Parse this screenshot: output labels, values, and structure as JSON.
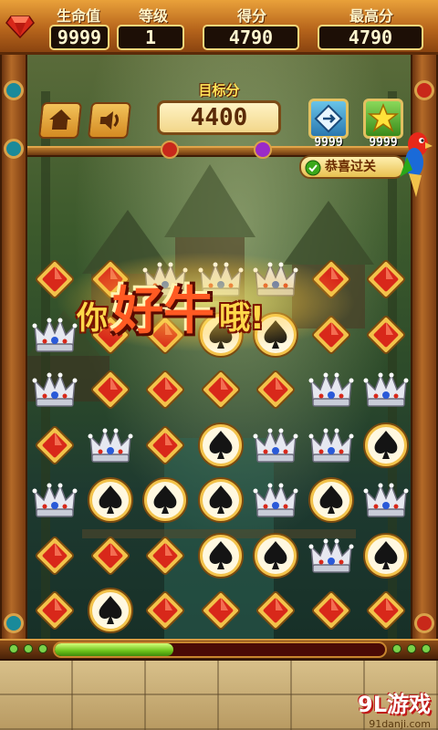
{
  "stats": {
    "lives_label": "生命值",
    "lives_value": "9999",
    "level_label": "等级",
    "level_value": "1",
    "score_label": "得分",
    "score_value": "4790",
    "best_label": "最高分",
    "best_value": "4790"
  },
  "hud": {
    "home_icon": "home-icon",
    "sound_icon": "sound-icon",
    "target_label": "目标分",
    "target_value": "4400",
    "powerup1_icon": "shuffle-icon",
    "powerup1_count": "9999",
    "powerup2_icon": "star-icon",
    "powerup2_count": "9999",
    "congrats_label": "恭喜过关"
  },
  "combo_text": {
    "part1": "你",
    "part2": "好牛",
    "part3": "哦!"
  },
  "board": {
    "rows": 7,
    "cols": 7,
    "grid": [
      [
        "diamond",
        "diamond",
        "crown",
        "crown",
        "crown",
        "diamond",
        "diamond"
      ],
      [
        "crown",
        "diamond",
        "diamond",
        "spade",
        "spade",
        "diamond",
        "diamond"
      ],
      [
        "crown",
        "diamond",
        "diamond",
        "diamond",
        "diamond",
        "crown",
        "crown"
      ],
      [
        "diamond",
        "crown",
        "diamond",
        "spade",
        "crown",
        "crown",
        "spade"
      ],
      [
        "crown",
        "spade",
        "spade",
        "spade",
        "crown",
        "spade",
        "crown"
      ],
      [
        "diamond",
        "diamond",
        "diamond",
        "spade",
        "spade",
        "crown",
        "spade"
      ],
      [
        "diamond",
        "spade",
        "diamond",
        "diamond",
        "diamond",
        "diamond",
        "diamond"
      ]
    ]
  },
  "progress": {
    "fraction": 0.36
  },
  "watermark": {
    "main": "9L游戏",
    "sub": "91danji.com"
  },
  "colors": {
    "diamond_red": "#d8281a",
    "gold": "#f2c24a",
    "spade_black": "#141414",
    "progress_green": "#6cc21a"
  }
}
